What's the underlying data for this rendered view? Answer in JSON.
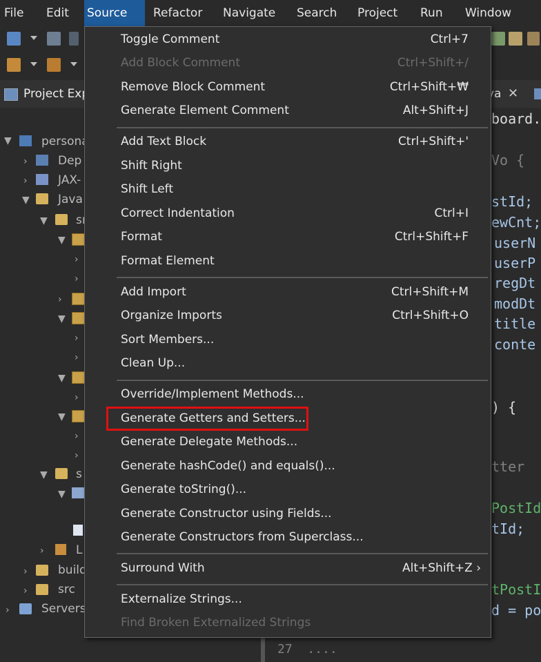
{
  "menubar": [
    "File",
    "Edit",
    "Source",
    "Refactor",
    "Navigate",
    "Search",
    "Project",
    "Run",
    "Window"
  ],
  "explorer": {
    "title": "Project Exp",
    "tree": [
      "persona",
      "Dep",
      "JAX-",
      "Java",
      "sr",
      "s",
      "L",
      "build",
      "src",
      "Servers"
    ]
  },
  "editor": {
    "tab_label": "va",
    "code": [
      "board.",
      "Vo {",
      "stId;",
      "ewCnt;",
      "userN",
      "userP",
      "regDt",
      "modDt",
      "title",
      "conte",
      ") {",
      "tter",
      "PostId",
      "tId;",
      "tPostI",
      "d = po",
      "27  ...."
    ]
  },
  "source_menu": [
    {
      "label": "Toggle Comment",
      "shortcut": "Ctrl+7"
    },
    {
      "label": "Add Block Comment",
      "shortcut": "Ctrl+Shift+/",
      "disabled": true
    },
    {
      "label": "Remove Block Comment",
      "shortcut": "Ctrl+Shift+₩"
    },
    {
      "label": "Generate Element Comment",
      "shortcut": "Alt+Shift+J"
    },
    {
      "label": "Add Text Block",
      "shortcut": "Ctrl+Shift+'"
    },
    {
      "label": "Shift Right",
      "shortcut": ""
    },
    {
      "label": "Shift Left",
      "shortcut": ""
    },
    {
      "label": "Correct Indentation",
      "shortcut": "Ctrl+I"
    },
    {
      "label": "Format",
      "shortcut": "Ctrl+Shift+F"
    },
    {
      "label": "Format Element",
      "shortcut": ""
    },
    {
      "label": "Add Import",
      "shortcut": "Ctrl+Shift+M"
    },
    {
      "label": "Organize Imports",
      "shortcut": "Ctrl+Shift+O"
    },
    {
      "label": "Sort Members...",
      "shortcut": ""
    },
    {
      "label": "Clean Up...",
      "shortcut": ""
    },
    {
      "label": "Override/Implement Methods...",
      "shortcut": ""
    },
    {
      "label": "Generate Getters and Setters...",
      "shortcut": "",
      "highlighted": true
    },
    {
      "label": "Generate Delegate Methods...",
      "shortcut": ""
    },
    {
      "label": "Generate hashCode() and equals()...",
      "shortcut": ""
    },
    {
      "label": "Generate toString()...",
      "shortcut": ""
    },
    {
      "label": "Generate Constructor using Fields...",
      "shortcut": ""
    },
    {
      "label": "Generate Constructors from Superclass...",
      "shortcut": ""
    },
    {
      "label": "Surround With",
      "shortcut": "Alt+Shift+Z ›"
    },
    {
      "label": "Externalize Strings...",
      "shortcut": ""
    },
    {
      "label": "Find Broken Externalized Strings",
      "shortcut": "",
      "disabled": true
    }
  ],
  "colors": {
    "menubar_active": "#1e5b9a",
    "highlight_box": "#e01010"
  }
}
